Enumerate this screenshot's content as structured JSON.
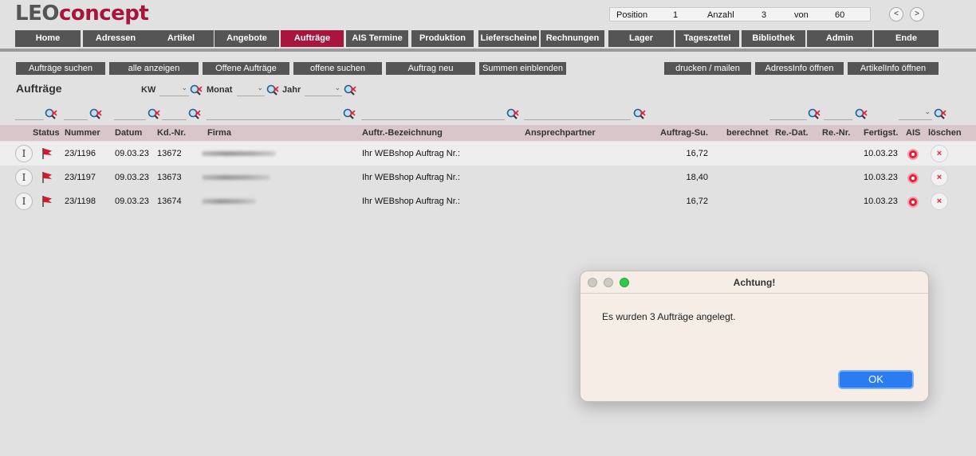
{
  "app": {
    "logo_leo": "LEO",
    "logo_concept": "concept"
  },
  "position": {
    "position_label": "Position",
    "position_value": "1",
    "count_label": "Anzahl",
    "count_value": "3",
    "of_label": "von",
    "of_value": "60",
    "prev_label": "<",
    "next_label": ">"
  },
  "menu": {
    "items": [
      {
        "label": "Home"
      },
      {
        "label": "Adressen"
      },
      {
        "label": "Artikel"
      },
      {
        "label": "Angebote"
      },
      {
        "label": "Aufträge"
      },
      {
        "label": "AIS Termine"
      },
      {
        "label": "Produktion"
      },
      {
        "label": "Lieferscheine"
      },
      {
        "label": "Rechnungen"
      },
      {
        "label": "Lager"
      },
      {
        "label": "Tageszettel"
      },
      {
        "label": "Bibliothek"
      },
      {
        "label": "Admin"
      },
      {
        "label": "Ende"
      }
    ],
    "active_index": 4
  },
  "toolbar": {
    "search_orders": "Aufträge suchen",
    "show_all": "alle anzeigen",
    "open_orders": "Offene Aufträge",
    "open_search": "offene suchen",
    "new_order": "Auftrag neu",
    "show_sums": "Summen einblenden",
    "print_mail": "drucken / mailen",
    "open_address_info": "AdressInfo öffnen",
    "open_article_info": "ArtikelInfo öffnen"
  },
  "filters": {
    "section_title": "Aufträge",
    "kw_label": "KW",
    "month_label": "Monat",
    "year_label": "Jahr"
  },
  "table": {
    "headers": {
      "status": "Status",
      "number": "Nummer",
      "date": "Datum",
      "customer_no": "Kd.-Nr.",
      "company": "Firma",
      "description": "Auftr.-Bezeichnung",
      "contact": "Ansprechpartner",
      "order_sum": "Auftrag-Su.",
      "billed": "berechnet",
      "invoice_date": "Re.-Dat.",
      "invoice_no": "Re.-Nr.",
      "finished": "Fertigst.",
      "ais": "AIS",
      "delete": "löschen"
    },
    "info_label": "I",
    "delete_label": "×",
    "rows": [
      {
        "number": "23/1196",
        "date": "09.03.23",
        "customer_no": "13672",
        "description": "Ihr WEBshop Auftrag Nr.:",
        "order_sum": "16,72",
        "finished": "10.03.23"
      },
      {
        "number": "23/1197",
        "date": "09.03.23",
        "customer_no": "13673",
        "description": "Ihr WEBshop Auftrag Nr.:",
        "order_sum": "18,40",
        "finished": "10.03.23"
      },
      {
        "number": "23/1198",
        "date": "09.03.23",
        "customer_no": "13674",
        "description": "Ihr WEBshop Auftrag Nr.:",
        "order_sum": "16,72",
        "finished": "10.03.23"
      }
    ]
  },
  "dialog": {
    "title": "Achtung!",
    "message": "Es wurden 3 Aufträge angelegt.",
    "ok_label": "OK"
  },
  "colors": {
    "brand": "#a8153c",
    "menu_bg": "#555555",
    "header_bg": "#d9c6cb",
    "ok_blue": "#2a7cf0"
  }
}
